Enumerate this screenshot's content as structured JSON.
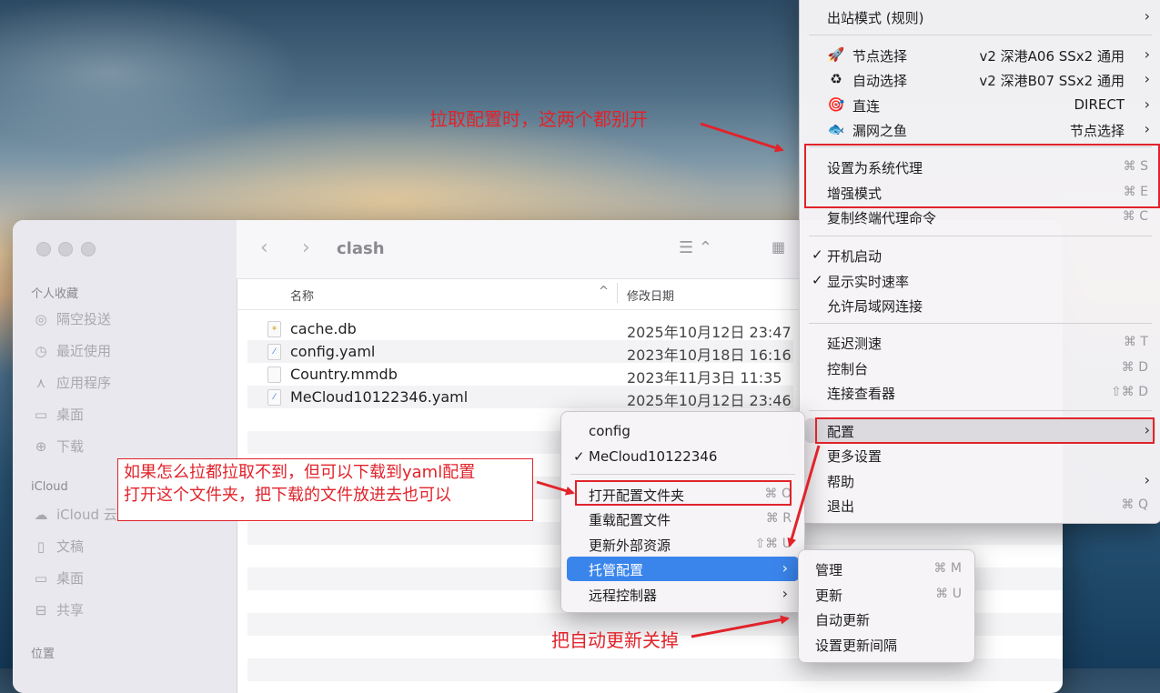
{
  "finder": {
    "title": "clash",
    "sidebar": {
      "favorites_head": "个人收藏",
      "favorites": [
        "隔空投送",
        "最近使用",
        "应用程序",
        "桌面",
        "下载"
      ],
      "icloud_head": "iCloud",
      "icloud": [
        "iCloud 云盘",
        "文稿",
        "桌面",
        "共享"
      ],
      "locations_head": "位置"
    },
    "columns": {
      "name": "名称",
      "date": "修改日期"
    },
    "files": [
      {
        "name": "cache.db",
        "date": "2025年10月12日 23:47"
      },
      {
        "name": "config.yaml",
        "date": "2023年10月18日 16:16"
      },
      {
        "name": "Country.mmdb",
        "date": "2023年11月3日 11:35"
      },
      {
        "name": "MeCloud10122346.yaml",
        "date": "2025年10月12日 23:46"
      }
    ]
  },
  "main_menu": {
    "outbound": "出站模式 (规则)",
    "proxies": [
      {
        "icon": "rocket-icon",
        "label": "节点选择",
        "value": "v2 深港A06 SSx2 通用"
      },
      {
        "icon": "recycle-icon",
        "label": "自动选择",
        "value": "v2 深港B07 SSx2 通用"
      },
      {
        "icon": "target-icon",
        "label": "直连",
        "value": "DIRECT"
      },
      {
        "icon": "fish-icon",
        "label": "漏网之鱼",
        "value": "节点选择"
      }
    ],
    "system_proxy": {
      "label": "设置为系统代理",
      "shortcut": "⌘ S"
    },
    "enhanced": {
      "label": "增强模式",
      "shortcut": "⌘ E"
    },
    "copy_cmd": {
      "label": "复制终端代理命令",
      "shortcut": "⌘ C"
    },
    "startup": "开机启动",
    "speed": "显示实时速率",
    "lan": "允许局域网连接",
    "latency": {
      "label": "延迟测速",
      "shortcut": "⌘ T"
    },
    "console": {
      "label": "控制台",
      "shortcut": "⌘ D"
    },
    "conn": {
      "label": "连接查看器",
      "shortcut": "⇧⌘ D"
    },
    "config": "配置",
    "more": "更多设置",
    "help": "帮助",
    "quit": {
      "label": "退出",
      "shortcut": "⌘ Q"
    }
  },
  "config_menu": {
    "item1": "config",
    "item2": "MeCloud10122346",
    "open_folder": {
      "label": "打开配置文件夹",
      "shortcut": "⌘ O"
    },
    "reload": {
      "label": "重载配置文件",
      "shortcut": "⌘ R"
    },
    "update_ext": {
      "label": "更新外部资源",
      "shortcut": "⇧⌘ U"
    },
    "managed": "托管配置",
    "remote": "远程控制器"
  },
  "managed_menu": {
    "manage": {
      "label": "管理",
      "shortcut": "⌘ M"
    },
    "update": {
      "label": "更新",
      "shortcut": "⌘ U"
    },
    "auto_update": "自动更新",
    "interval": "设置更新间隔"
  },
  "annotations": {
    "top": "拉取配置时，这两个都别开",
    "left_line1": "如果怎么拉都拉取不到，但可以下载到yaml配置",
    "left_line2": "打开这个文件夹，把下载的文件放进去也可以",
    "bottom": "把自动更新关掉"
  },
  "colors": {
    "annotation_red": "#e1232b",
    "menu_highlight": "#3a85ec"
  }
}
